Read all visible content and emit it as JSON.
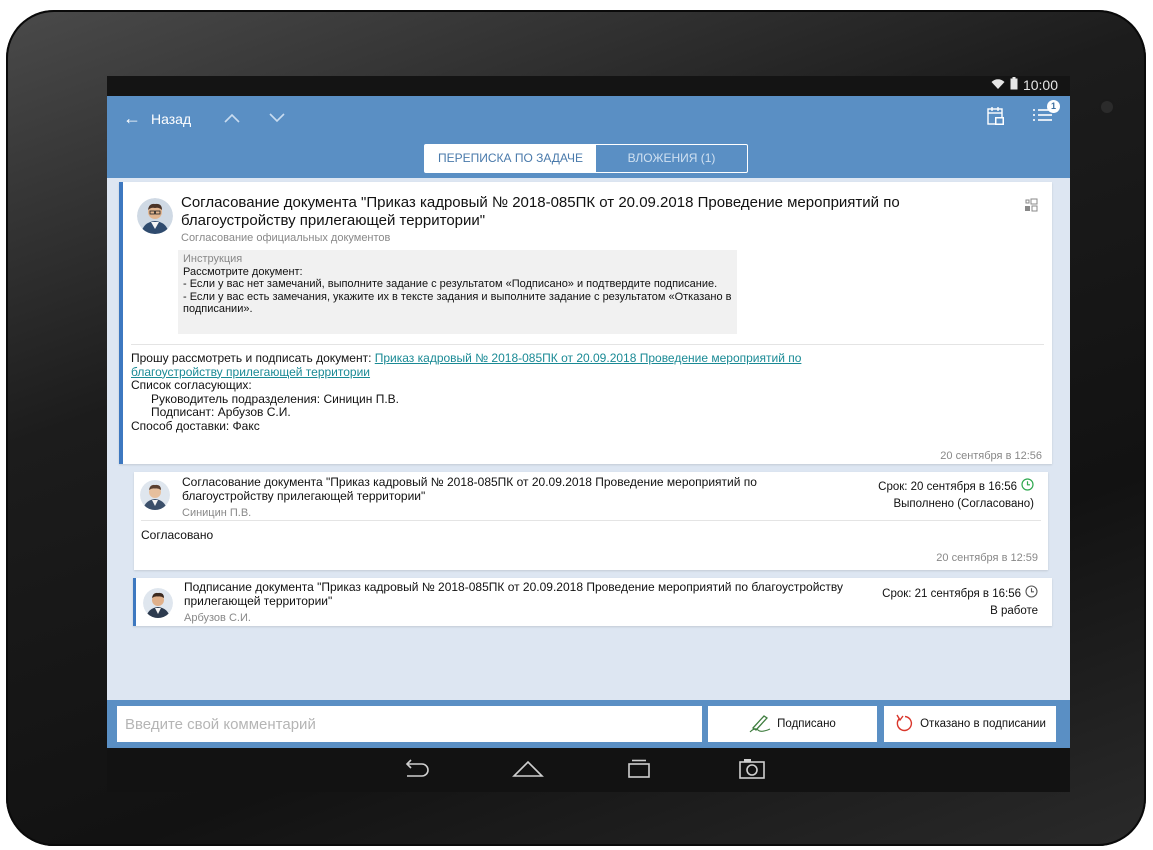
{
  "status": {
    "time": "10:00"
  },
  "header": {
    "back_label": "Назад",
    "notifications_badge": "1"
  },
  "tabs": [
    {
      "label": "ПЕРЕПИСКА ПО ЗАДАЧЕ",
      "active": true
    },
    {
      "label": "ВЛОЖЕНИЯ (1)",
      "active": false
    }
  ],
  "main_task": {
    "title": "Согласование документа \"Приказ кадровый № 2018-085ПК от 20.09.2018 Проведение мероприятий по благоустройству прилегающей территории\"",
    "subtitle": "Согласование официальных документов",
    "instruction": {
      "heading": "Инструкция",
      "lines": [
        "Рассмотрите документ:",
        "- Если у вас нет замечаний, выполните задание с результатом «Подписано» и подтвердите подписание.",
        "- Если у вас есть замечания, укажите их в тексте задания и выполните задание с результатом «Отказано в подписании»."
      ]
    },
    "body_prefix": "Прошу рассмотреть и подписать документ: ",
    "document_link": "Приказ кадровый № 2018-085ПК от 20.09.2018 Проведение мероприятий по благоустройству прилегающей территории",
    "approvers_heading": "Список согласующих:",
    "approvers": [
      "Руководитель подразделения: Синицин П.В.",
      "Подписант: Арбузов С.И."
    ],
    "delivery": "Способ доставки: Факс",
    "timestamp": "20 сентября в 12:56"
  },
  "subtask_1": {
    "title": "Согласование документа \"Приказ кадровый № 2018-085ПК от 20.09.2018 Проведение мероприятий по благоустройству прилегающей территории\"",
    "author": "Синицин П.В.",
    "due": "Срок: 20 сентября в 16:56",
    "status": "Выполнено (Согласовано)",
    "comment": "Согласовано",
    "timestamp": "20 сентября в 12:59"
  },
  "subtask_2": {
    "title": "Подписание документа \"Приказ кадровый № 2018-085ПК от 20.09.2018 Проведение мероприятий по благоустройству прилегающей территории\"",
    "author": "Арбузов С.И.",
    "due": "Срок: 21 сентября в 16:56",
    "status": "В работе"
  },
  "composer": {
    "placeholder": "Введите свой комментарий",
    "sign_label": "Подписано",
    "reject_label": "Отказано в подписании"
  },
  "colors": {
    "accent": "#5a8fc4",
    "card_border": "#3d78c0",
    "link": "#1a8a95",
    "done_clock": "#2fa84f",
    "reject_icon": "#d9362b"
  }
}
